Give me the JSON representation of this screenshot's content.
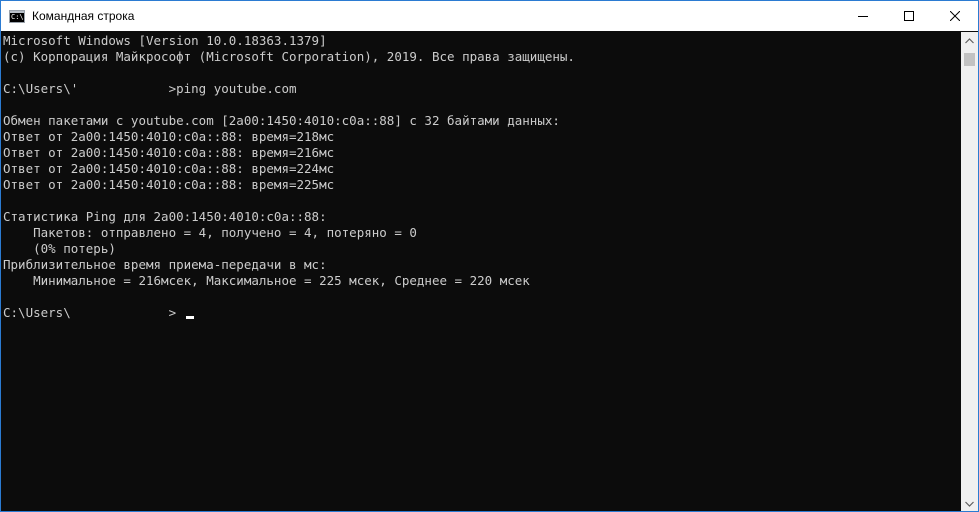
{
  "window": {
    "title": "Командная строка",
    "app_icon": "cmd-icon",
    "app_icon_text": "C:\\",
    "controls": [
      "minimize-icon",
      "maximize-icon",
      "close-icon"
    ]
  },
  "console": {
    "lines": [
      "Microsoft Windows [Version 10.0.18363.1379]",
      "(c) Корпорация Майкрософт (Microsoft Corporation), 2019. Все права защищены.",
      "",
      "C:\\Users\\'            >ping youtube.com",
      "",
      "Обмен пакетами с youtube.com [2a00:1450:4010:c0a::88] с 32 байтами данных:",
      "Ответ от 2a00:1450:4010:c0a::88: время=218мс",
      "Ответ от 2a00:1450:4010:c0a::88: время=216мс",
      "Ответ от 2a00:1450:4010:c0a::88: время=224мс",
      "Ответ от 2a00:1450:4010:c0a::88: время=225мс",
      "",
      "Статистика Ping для 2a00:1450:4010:c0a::88:",
      "    Пакетов: отправлено = 4, получено = 4, потеряно = 0",
      "    (0% потерь)",
      "Приблизительное время приема-передачи в мс:",
      "    Минимальное = 216мсек, Максимальное = 225 мсек, Среднее = 220 мсек",
      "",
      "C:\\Users\\             >"
    ]
  },
  "colors": {
    "console_bg": "#0c0c0c",
    "console_text": "#cccccc",
    "titlebar_bg": "#ffffff",
    "window_border": "#2b7bd2",
    "scrollbar_bg": "#f0f0f0"
  }
}
